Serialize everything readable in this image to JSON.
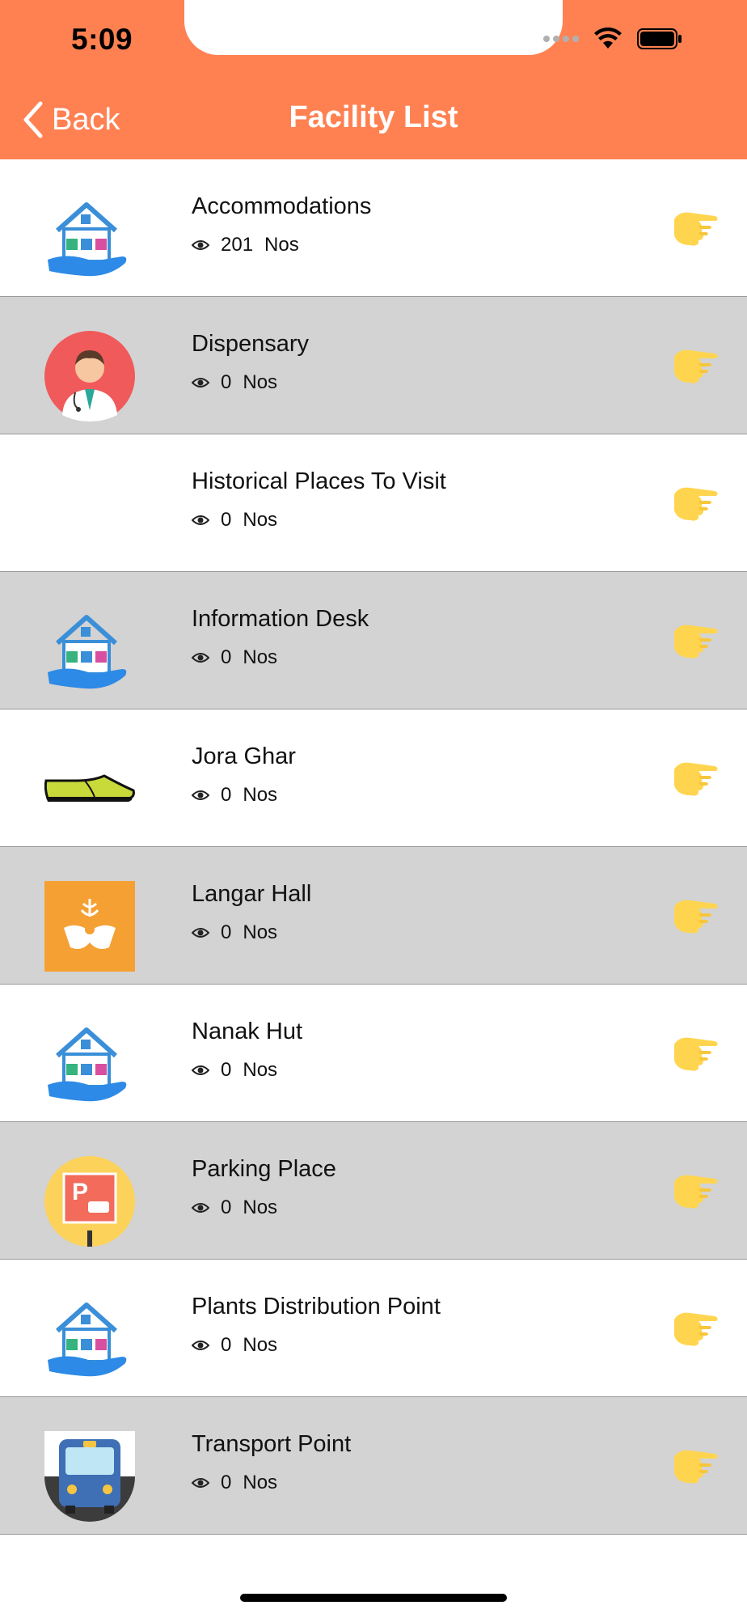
{
  "status_bar": {
    "time": "5:09"
  },
  "nav": {
    "back_label": "Back",
    "title": "Facility List"
  },
  "colors": {
    "header": "#FF8152",
    "alt_row": "#d3d3d3",
    "pointer": "#FFD54F"
  },
  "facilities": [
    {
      "name": "Accommodations",
      "count": "201",
      "unit": "Nos",
      "icon": "house-hand-icon"
    },
    {
      "name": "Dispensary",
      "count": "0",
      "unit": "Nos",
      "icon": "doctor-icon"
    },
    {
      "name": "Historical Places To Visit",
      "count": "0",
      "unit": "Nos",
      "icon": ""
    },
    {
      "name": "Information Desk",
      "count": "0",
      "unit": "Nos",
      "icon": "house-hand-icon"
    },
    {
      "name": "Jora Ghar",
      "count": "0",
      "unit": "Nos",
      "icon": "shoe-icon"
    },
    {
      "name": "Langar Hall",
      "count": "0",
      "unit": "Nos",
      "icon": "langar-icon"
    },
    {
      "name": "Nanak Hut",
      "count": "0",
      "unit": "Nos",
      "icon": "house-hand-icon"
    },
    {
      "name": "Parking Place",
      "count": "0",
      "unit": "Nos",
      "icon": "parking-icon"
    },
    {
      "name": "Plants Distribution Point",
      "count": "0",
      "unit": "Nos",
      "icon": "house-hand-icon"
    },
    {
      "name": "Transport Point",
      "count": "0",
      "unit": "Nos",
      "icon": "bus-icon"
    }
  ]
}
